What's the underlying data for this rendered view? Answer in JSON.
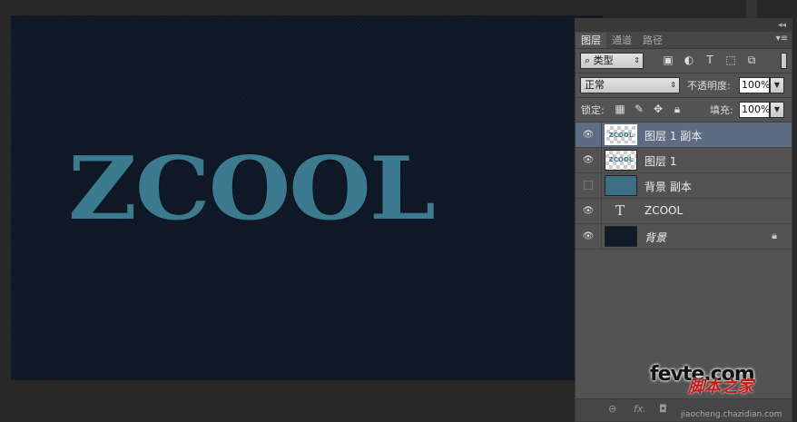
{
  "canvas": {
    "text": "ZCOOL"
  },
  "layers_panel": {
    "collapse_icon": "◂◂",
    "tabs": [
      "图层",
      "通道",
      "路径"
    ],
    "menu_icon": "▾≡",
    "filter": {
      "icon": "search-icon",
      "label": "类型"
    },
    "blend_mode": "正常",
    "opacity_label": "不透明度:",
    "opacity": "100%",
    "lock_label": "锁定:",
    "fill_label": "填充:",
    "fill": "100%",
    "layers": [
      {
        "name": "图层 1 副本",
        "visible": true,
        "selected": true
      },
      {
        "name": "图层 1",
        "visible": true
      },
      {
        "name": "背景 副本",
        "visible": false
      },
      {
        "name": "ZCOOL",
        "visible": true,
        "type": "text"
      },
      {
        "name": "背景",
        "visible": true,
        "locked": true
      }
    ],
    "footer": {
      "link": "⊖",
      "fx": "fx.",
      "mask": "◘"
    }
  },
  "watermark": {
    "main": "fevte.com",
    "cn": "脚本之家",
    "url": "jiaocheng.chazidian.com"
  },
  "colors": {
    "canvas_bg": "#0f1826",
    "text_teal": "#3c7a8f",
    "panel_bg": "#535353",
    "selected_row": "#5d6c82"
  }
}
